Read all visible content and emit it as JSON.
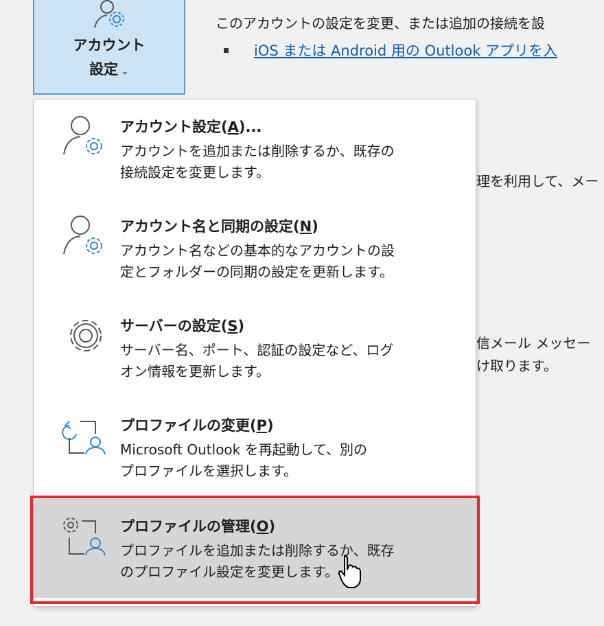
{
  "ribbon": {
    "icon": "account-gear-icon",
    "label_line1": "アカウント",
    "label_line2": "設定",
    "dropdown_glyph": "⌄"
  },
  "background": {
    "line1": "このアカウントの設定を変更、または追加の接続を設",
    "link": "iOS または Android 用の Outlook アプリを入",
    "line2": "理を利用して、メー",
    "line3": "信メール メッセー",
    "line4": "け取ります。"
  },
  "menu": {
    "items": [
      {
        "icon": "account-gear-icon",
        "title": "アカウント設定(",
        "accel": "A",
        "title_end": ")...",
        "desc_line1": "アカウントを追加または削除するか、既存の",
        "desc_line2": "接続設定を変更します。"
      },
      {
        "icon": "account-sync-gear-icon",
        "title": "アカウント名と同期の設定(",
        "accel": "N",
        "title_end": ")",
        "desc_line1": "アカウント名などの基本的なアカウントの設",
        "desc_line2": "定とフォルダーの同期の設定を更新します。"
      },
      {
        "icon": "gear-icon",
        "title": "サーバーの設定(",
        "accel": "S",
        "title_end": ")",
        "desc_line1": "サーバー名、ポート、認証の設定など、ログ",
        "desc_line2": "オン情報を更新します。"
      },
      {
        "icon": "change-profile-icon",
        "title": "プロファイルの変更(",
        "accel": "P",
        "title_end": ")",
        "desc_line1": "Microsoft Outlook を再起動して、別の",
        "desc_line2": "プロファイルを選択します。"
      },
      {
        "icon": "manage-profile-icon",
        "title": "プロファイルの管理(",
        "accel": "O",
        "title_end": ")",
        "desc_line1": "プロファイルを追加または削除するか、既存",
        "desc_line2": "のプロファイル設定を変更します。"
      }
    ]
  },
  "colors": {
    "accent_blue": "#2f8bd6",
    "highlight_border": "#e2292b",
    "hover_bg": "#d6d6d6",
    "ribbon_bg": "#cde4f7"
  },
  "cursor": "mouse-pointer-icon"
}
